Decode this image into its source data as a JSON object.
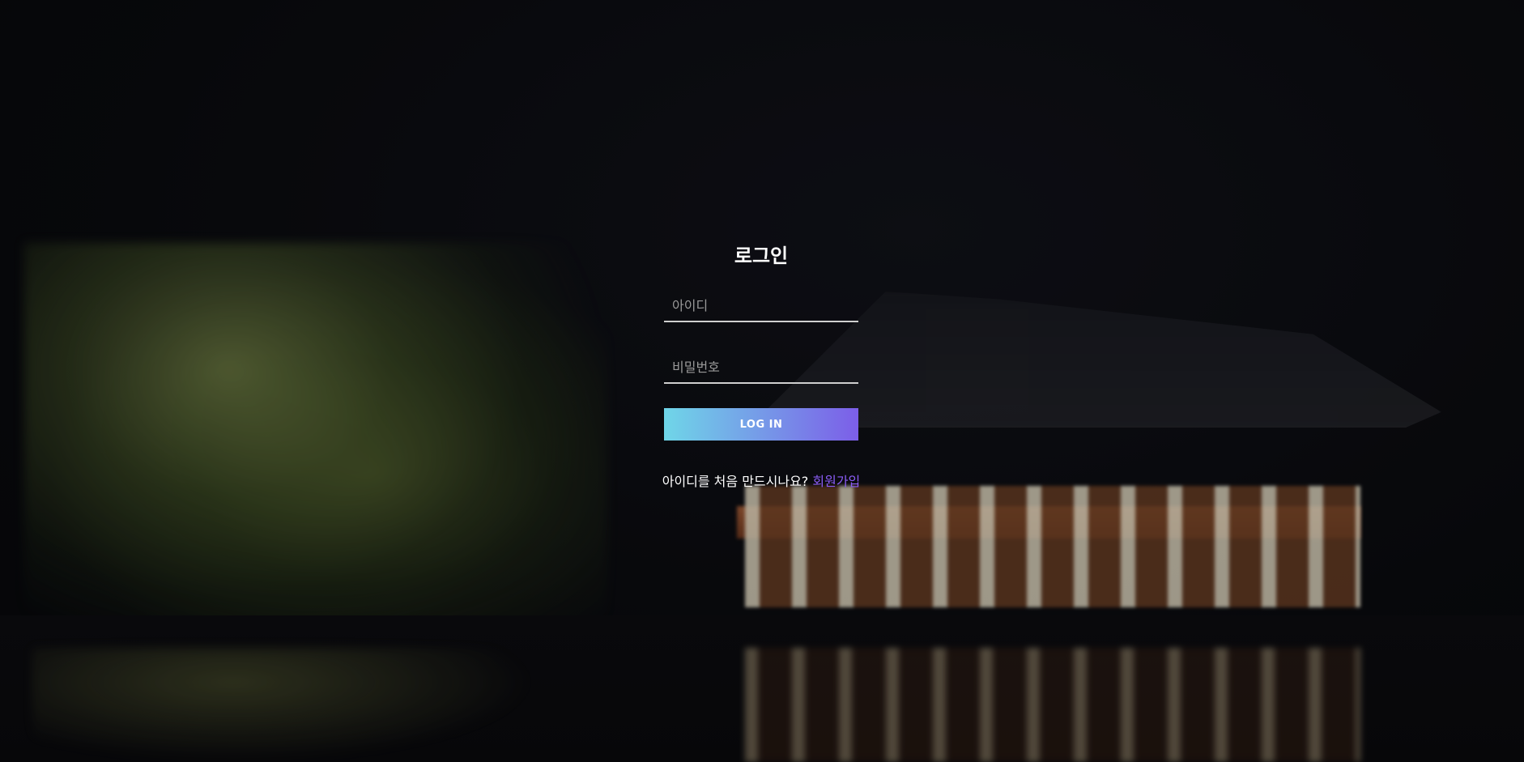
{
  "login": {
    "title": "로그인",
    "username_placeholder": "아이디",
    "password_placeholder": "비밀번호",
    "button_label": "LOG IN",
    "signup_prompt": "아이디를 처음 만드시나요? ",
    "signup_link": "회원가입"
  },
  "colors": {
    "button_gradient_start": "#6fd6e8",
    "button_gradient_end": "#7c5ee8",
    "link": "#8b5cf6",
    "text": "#ffffff"
  },
  "background": {
    "scene": "night-pavilion-photo"
  }
}
